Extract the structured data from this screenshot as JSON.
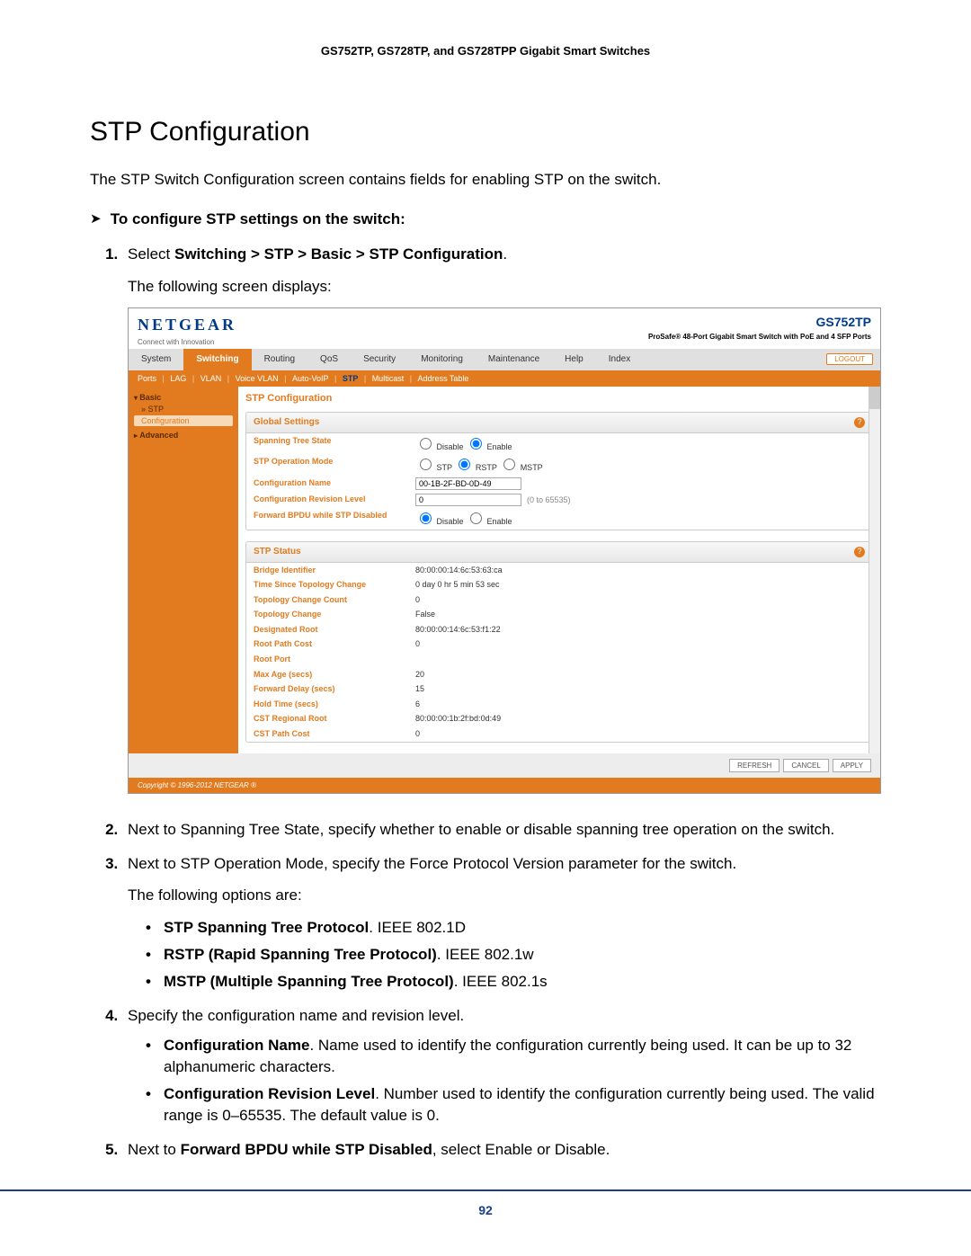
{
  "doc": {
    "header": "GS752TP, GS728TP, and GS728TPP Gigabit Smart Switches",
    "section_title": "STP Configuration",
    "intro": "The STP Switch Configuration screen contains fields for enabling STP on the switch.",
    "proc_arrow": "➤",
    "proc_title": "To configure STP settings on the switch:",
    "steps": [
      {
        "text": "Select ",
        "bold_parts": "Switching > STP > Basic > STP Configuration",
        "suffix": ".",
        "sub": "The following screen displays:"
      },
      {
        "text": "Next to Spanning Tree State, specify whether to enable or disable spanning tree operation on the switch."
      },
      {
        "text": "Next to STP Operation Mode, specify the Force Protocol Version parameter for the switch.",
        "sub": "The following options are:",
        "bullets": [
          {
            "b": "STP Spanning Tree Protocol",
            "t": ". IEEE 802.1D"
          },
          {
            "b": "RSTP (Rapid Spanning Tree Protocol)",
            "t": ". IEEE 802.1w"
          },
          {
            "b": "MSTP (Multiple Spanning Tree Protocol)",
            "t": ". IEEE 802.1s"
          }
        ]
      },
      {
        "text": "Specify the configuration name and revision level.",
        "bullets2": [
          {
            "b": "Configuration Name",
            "t": ". Name used to identify the configuration currently being used. It can be up to 32 alphanumeric characters."
          },
          {
            "b": "Configuration Revision Level",
            "t": ". Number used to identify the configuration currently being used. The valid range is 0–65535. The default value is 0."
          }
        ]
      },
      {
        "text_parts": [
          "Next to ",
          "Forward BPDU while STP Disabled",
          ", select Enable or Disable."
        ]
      }
    ],
    "page_number": "92"
  },
  "ui": {
    "logo": "NETGEAR",
    "tagline": "Connect with Innovation",
    "model": "GS752TP",
    "model_sub": "ProSafe® 48-Port Gigabit Smart Switch\nwith PoE and 4 SFP Ports",
    "tabs": [
      "System",
      "Switching",
      "Routing",
      "QoS",
      "Security",
      "Monitoring",
      "Maintenance",
      "Help",
      "Index"
    ],
    "active_tab": 1,
    "logout": "LOGOUT",
    "subtabs": [
      "Ports",
      "LAG",
      "VLAN",
      "Voice VLAN",
      "Auto-VoIP",
      "STP",
      "Multicast",
      "Address Table"
    ],
    "sub_highlight": 5,
    "side": {
      "group1": "Basic",
      "items1": [
        "STP",
        "Configuration"
      ],
      "group2": "Advanced"
    },
    "main_title": "STP Configuration",
    "panel1": {
      "title": "Global Settings",
      "rows": [
        {
          "label": "Spanning Tree State",
          "type": "radio",
          "opts": [
            "Disable",
            "Enable"
          ],
          "sel": 1
        },
        {
          "label": "STP Operation Mode",
          "type": "radio",
          "opts": [
            "STP",
            "RSTP",
            "MSTP"
          ],
          "sel": 1
        },
        {
          "label": "Configuration Name",
          "type": "input",
          "val": "00-1B-2F-BD-0D-49"
        },
        {
          "label": "Configuration Revision Level",
          "type": "input",
          "val": "0",
          "note": "(0 to 65535)"
        },
        {
          "label": "Forward BPDU while STP Disabled",
          "type": "radio",
          "opts": [
            "Disable",
            "Enable"
          ],
          "sel": 0
        }
      ]
    },
    "panel2": {
      "title": "STP Status",
      "rows": [
        {
          "label": "Bridge Identifier",
          "val": "80:00:00:14:6c:53:63:ca"
        },
        {
          "label": "Time Since Topology Change",
          "val": "0 day 0 hr 5 min 53 sec"
        },
        {
          "label": "Topology Change Count",
          "val": "0"
        },
        {
          "label": "Topology Change",
          "val": "False"
        },
        {
          "label": "Designated Root",
          "val": "80:00:00:14:6c:53:f1:22"
        },
        {
          "label": "Root Path Cost",
          "val": "0"
        },
        {
          "label": "Root Port",
          "val": ""
        },
        {
          "label": "Max Age (secs)",
          "val": "20"
        },
        {
          "label": "Forward Delay (secs)",
          "val": "15"
        },
        {
          "label": "Hold Time (secs)",
          "val": "6"
        },
        {
          "label": "CST Regional Root",
          "val": "80:00:00:1b:2f:bd:0d:49"
        },
        {
          "label": "CST Path Cost",
          "val": "0"
        }
      ]
    },
    "buttons": [
      "REFRESH",
      "CANCEL",
      "APPLY"
    ],
    "copyright": "Copyright © 1996-2012 NETGEAR ®"
  }
}
